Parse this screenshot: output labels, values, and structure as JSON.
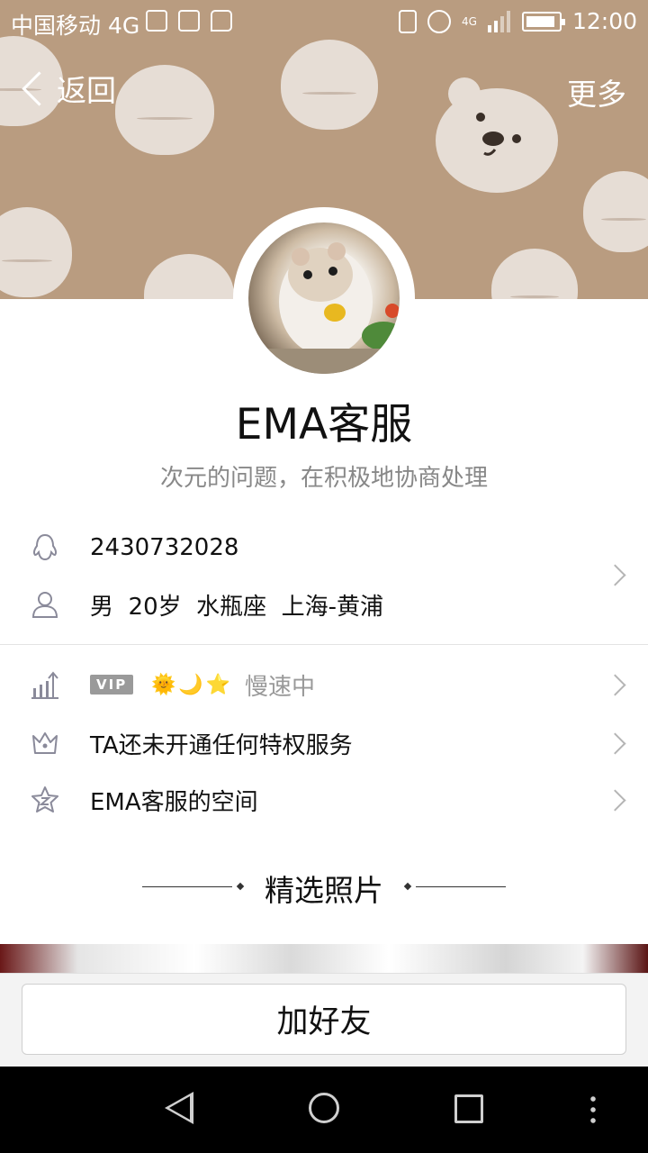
{
  "status_bar": {
    "carrier": "中国移动 4G",
    "network_badge": "4G",
    "time": "12:00",
    "battery_level": 0.9,
    "left_icons": [
      "notification-icon",
      "image-icon",
      "message-icon"
    ],
    "right_icons": [
      "vibrate-icon",
      "alarm-icon",
      "signal-icon",
      "battery-icon"
    ]
  },
  "header": {
    "back_label": "返回",
    "more_label": "更多"
  },
  "profile": {
    "nickname": "EMA客服",
    "signature": "次元的问题，在积极地协商处理",
    "qq_number": "2430732028",
    "info": "男  20岁  水瓶座  上海-黄浦"
  },
  "level": {
    "vip_badge": "VIP",
    "icons": [
      "🌞",
      "🌙",
      "⭐"
    ],
    "speed_text": "慢速中"
  },
  "privilege": {
    "label": "TA还未开通任何特权服务"
  },
  "space": {
    "label": "EMA客服的空间"
  },
  "photos": {
    "section_title": "精选照片"
  },
  "actions": {
    "add_friend_label": "加好友"
  },
  "colors": {
    "cover_bg": "#b99c80",
    "bun": "#e6ddd5",
    "text_primary": "#111111",
    "text_secondary": "#888888",
    "icon_gray": "#8a8a9a"
  }
}
